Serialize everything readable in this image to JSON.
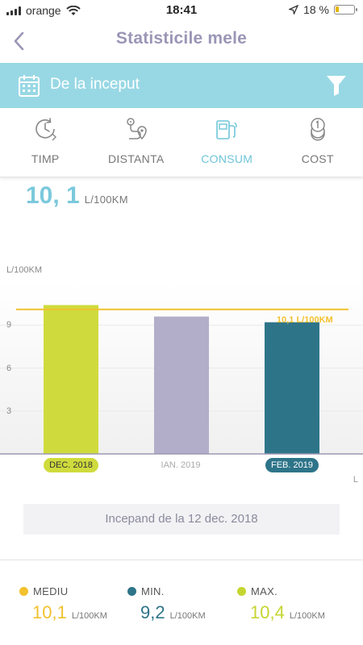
{
  "status_bar": {
    "carrier": "orange",
    "time": "18:41",
    "battery": "18 %",
    "battery_level": 0.18
  },
  "header": {
    "title": "Statisticile mele"
  },
  "date_filter": {
    "label": "De la inceput"
  },
  "tabs": [
    {
      "label": "TIMP",
      "icon": "clock-refresh-icon",
      "active": false
    },
    {
      "label": "DISTANTA",
      "icon": "route-pin-icon",
      "active": false
    },
    {
      "label": "CONSUM",
      "icon": "fuel-pump-icon",
      "active": true
    },
    {
      "label": "COST",
      "icon": "coins-icon",
      "active": false
    }
  ],
  "summary": {
    "value": "10, 1",
    "unit": "L/100KM"
  },
  "chart_data": {
    "type": "bar",
    "ylabel": "L/100KM",
    "xlabel": "L",
    "ylim": [
      0,
      12
    ],
    "yticks": [
      "3",
      "6",
      "9"
    ],
    "categories": [
      "DEC. 2018",
      "IAN. 2019",
      "FEB. 2019"
    ],
    "values": [
      10.4,
      9.6,
      9.2
    ],
    "colors": [
      "#cfdb3c",
      "#b2aec9",
      "#2e7489"
    ],
    "mean": {
      "value": 10.1,
      "label": "10,1 L/100KM",
      "color": "#f2c12e"
    }
  },
  "since_note": "Incepand de la 12 dec. 2018",
  "stats": [
    {
      "label": "MEDIU",
      "value": "10,1",
      "unit": "L/100KM",
      "color": "#f2c12e"
    },
    {
      "label": "MIN.",
      "value": "9,2",
      "unit": "L/100KM",
      "color": "#2e7489"
    },
    {
      "label": "MAX.",
      "value": "10,4",
      "unit": "L/100KM",
      "color": "#c5d530"
    }
  ]
}
